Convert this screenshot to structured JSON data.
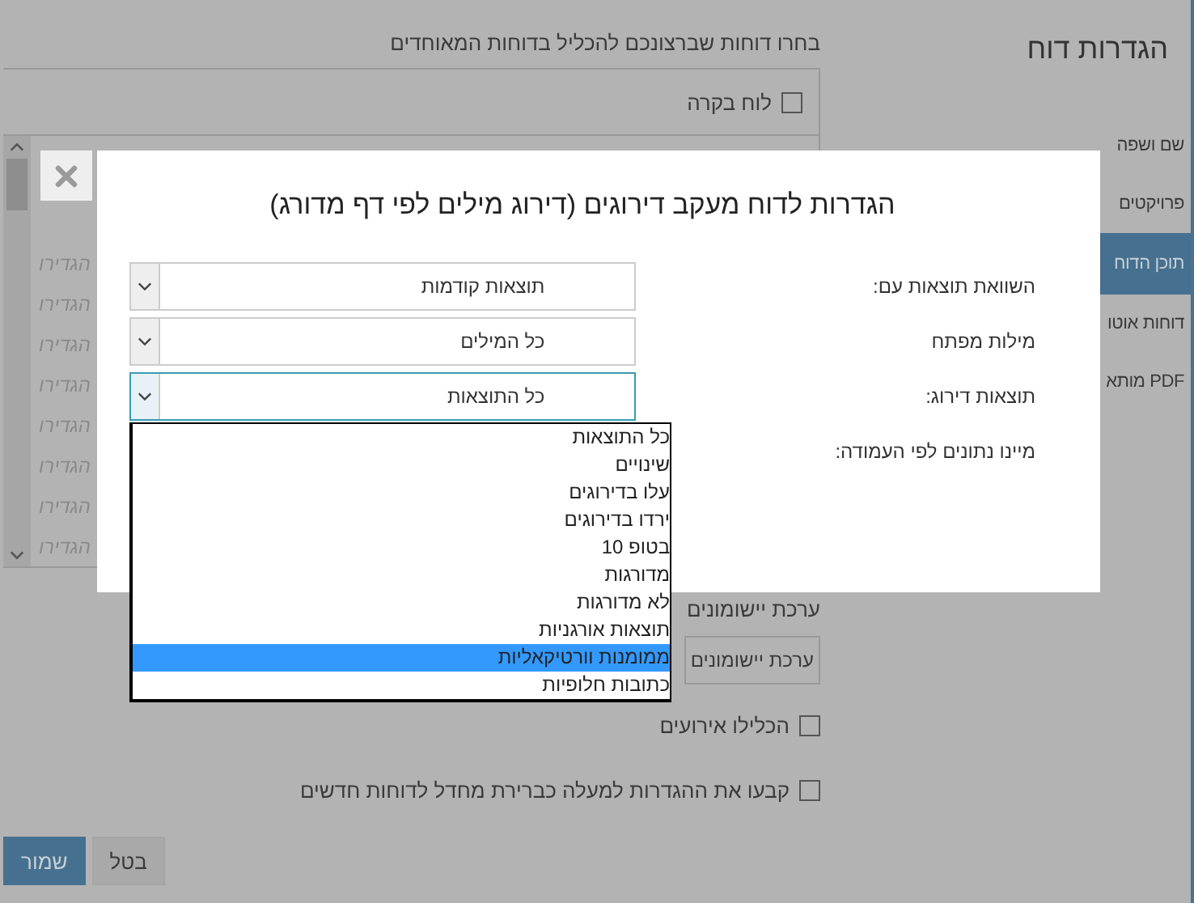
{
  "sidebar": {
    "title": "הגדרות דוח",
    "items": [
      {
        "label": "שם ושפה",
        "selected": false
      },
      {
        "label": "פרויקטים",
        "selected": false
      },
      {
        "label": "תוכן הדוח",
        "selected": true
      },
      {
        "label": "דוחות אוטו",
        "selected": false
      },
      {
        "label": "PDF מותא",
        "selected": false
      }
    ]
  },
  "main": {
    "heading": "בחרו דוחות שברצונכם להכליל בדוחות המאוחדים",
    "report_list": {
      "items": [
        {
          "label": "לוח בקרה",
          "checked": false
        }
      ],
      "row_links": [
        "הגדירו",
        "הגדירו",
        "הגדירו",
        "הגדירו",
        "הגדירו",
        "הגדירו",
        "הגדירו",
        "הגדירו"
      ]
    },
    "widget_set": {
      "label": "ערכת יישומונים",
      "button": "ערכת יישומונים"
    },
    "options": [
      {
        "label": "הכלילו אירועים",
        "checked": false
      },
      {
        "label": "קבעו את ההגדרות למעלה כברירת מחדל לדוחות חדשים",
        "checked": false
      }
    ],
    "buttons": [
      {
        "label": "בטל",
        "kind": "secondary"
      },
      {
        "label": "שמור",
        "kind": "primary"
      }
    ]
  },
  "dialog": {
    "title": "הגדרות לדוח מעקב דירוגים (דירוג מילים לפי דף מדורג)",
    "fields": [
      {
        "kind": "select",
        "label": "השוואת תוצאות עם:",
        "value": "תוצאות קודמות",
        "focused": false
      },
      {
        "kind": "select",
        "label": "מילות מפתח",
        "value": "כל המילים",
        "focused": false
      },
      {
        "kind": "select",
        "label": "תוצאות דירוג:",
        "value": "כל התוצאות",
        "focused": true
      },
      {
        "kind": "label",
        "label": "מיינו נתונים לפי העמודה:"
      }
    ],
    "dropdown": {
      "options": [
        {
          "label": "כל התוצאות",
          "selected": false
        },
        {
          "label": "שינויים",
          "selected": false
        },
        {
          "label": "עלו בדירוגים",
          "selected": false
        },
        {
          "label": "ירדו בדירוגים",
          "selected": false
        },
        {
          "label": "בטופ 10",
          "selected": false
        },
        {
          "label": "מדורגות",
          "selected": false
        },
        {
          "label": "לא מדורגות",
          "selected": false
        },
        {
          "label": "תוצאות אורגניות",
          "selected": false
        },
        {
          "label": "ממומנות וורטיקאליות",
          "selected": true
        },
        {
          "label": "כתובות חלופיות",
          "selected": false
        }
      ]
    }
  }
}
